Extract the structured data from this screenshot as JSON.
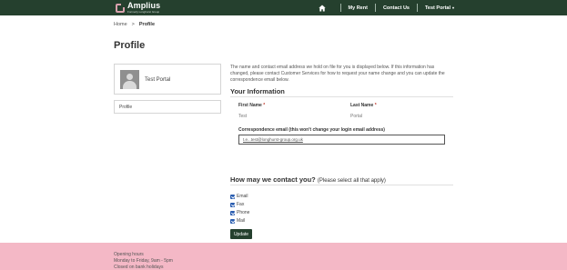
{
  "header": {
    "logo_name": "Amplius",
    "logo_sub": "Formerly Longhurst Group",
    "nav": {
      "home_icon": "home-icon",
      "my_rent": "My Rent",
      "contact_us": "Contact Us",
      "user_menu": "Test Portal",
      "user_menu_caret": "▾"
    }
  },
  "breadcrumb": {
    "home": "Home",
    "separator": ">",
    "current": "Profile"
  },
  "page_title": "Profile",
  "sidebar": {
    "profile_name": "Test Portal",
    "menu_item": "Profile"
  },
  "main": {
    "intro": "The name and contact email address we hold on file for you is displayed below. If this information has changed, please contact Customer Services for how to request your name change and you can update the correspondence email below.",
    "your_information_title": "Your Information",
    "first_name_label": "First Name",
    "first_name_value": "Test",
    "last_name_label": "Last Name",
    "last_name_value": "Portal",
    "required_marker": "*",
    "email_label": "Correspondence email (this won't change your login email address)",
    "email_value": "t.e...test@longhurst-group.org.uk",
    "contact_title": "How may we contact you?",
    "contact_subtitle": "(Please select all that apply)",
    "contact_options": [
      "Email",
      "Fax",
      "Phone",
      "Mail"
    ],
    "update_label": "Update"
  },
  "footer": {
    "line1": "Opening hours",
    "line2": "Monday to Friday, 9am - 5pm",
    "line3": "Closed on bank holidays"
  },
  "colors": {
    "header_bg": "#25402e",
    "footer_bg": "#f4b8c6",
    "accent": "#25402e",
    "checkbox": "#2a5db0"
  }
}
